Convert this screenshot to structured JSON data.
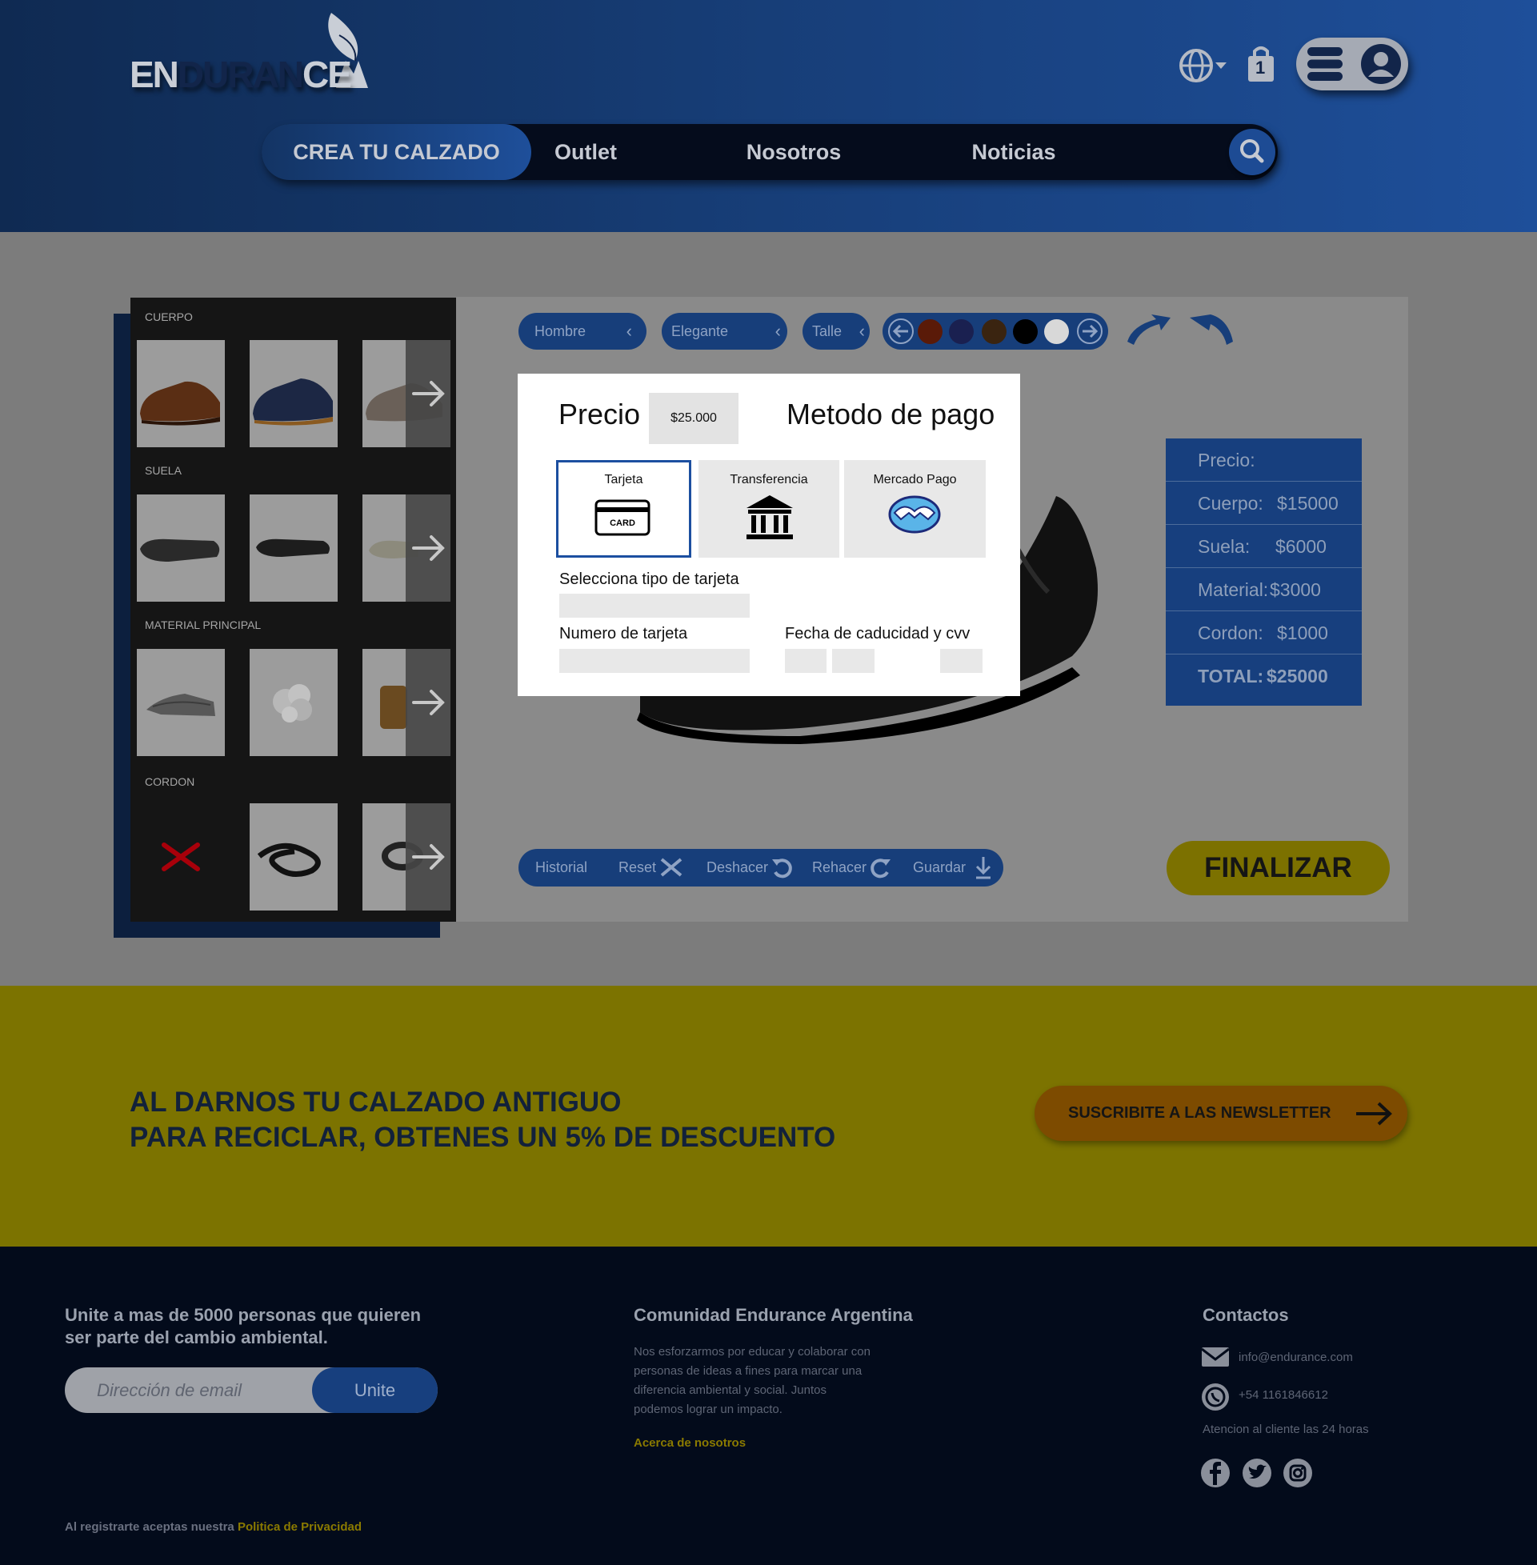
{
  "header": {
    "logo": {
      "part1": "EN",
      "part2": "DURAN",
      "part3": "CE"
    },
    "bag_count": "1",
    "nav": [
      {
        "label": "CREA TU CALZADO",
        "active": true
      },
      {
        "label": "Outlet"
      },
      {
        "label": "Nosotros"
      },
      {
        "label": "Noticias"
      }
    ]
  },
  "builder": {
    "sections": [
      {
        "label": "CUERPO"
      },
      {
        "label": "SUELA"
      },
      {
        "label": "MATERIAL PRINCIPAL"
      },
      {
        "label": "CORDON"
      }
    ],
    "filters": [
      {
        "label": "Hombre"
      },
      {
        "label": "Elegante"
      },
      {
        "label": "Talle"
      }
    ],
    "swatch_colors": [
      "#5a1a08",
      "#1a2050",
      "#3a2410",
      "#000000",
      "#d8d8d8"
    ],
    "price_table": {
      "header": "Precio:",
      "rows": [
        {
          "label": "Cuerpo:",
          "value": "$15000"
        },
        {
          "label": "Suela:",
          "value": "$6000"
        },
        {
          "label": "Material:",
          "value": "$3000"
        },
        {
          "label": "Cordon:",
          "value": "$1000"
        }
      ],
      "total_label": "TOTAL:",
      "total_value": "$25000"
    },
    "history": {
      "historial": "Historial",
      "reset": "Reset",
      "deshacer": "Deshacer",
      "rehacer": "Rehacer",
      "guardar": "Guardar"
    },
    "finalizar": "FINALIZAR"
  },
  "modal": {
    "precio_label": "Precio",
    "precio_value": "$25.000",
    "metodo_label": "Metodo de pago",
    "methods": [
      {
        "label": "Tarjeta",
        "selected": true
      },
      {
        "label": "Transferencia"
      },
      {
        "label": "Mercado Pago"
      }
    ],
    "card_text": "CARD",
    "tipo_tarjeta_label": "Selecciona tipo de tarjeta",
    "numero_label": "Numero de tarjeta",
    "fecha_label": "Fecha de caducidad y cvv"
  },
  "promo": {
    "line1": "AL DARNOS TU CALZADO ANTIGUO",
    "line2": "PARA RECICLAR, OBTENES UN 5% DE DESCUENTO",
    "newsletter_label": "SUSCRIBITE A LAS NEWSLETTER"
  },
  "footer": {
    "join_heading_1": "Unite a mas de 5000 personas que quieren",
    "join_heading_2": "ser parte del cambio ambiental.",
    "email_placeholder": "Dirección de email",
    "unite_label": "Unite",
    "community_heading": "Comunidad Endurance Argentina",
    "community_lines": [
      "Nos esforzarmos por educar y colaborar con",
      "personas de ideas a fines para marcar una",
      "diferencia ambiental y social. Juntos",
      "podemos lograr un impacto."
    ],
    "about_link": "Acerca de nosotros",
    "contacts_heading": "Contactos",
    "email": "info@endurance.com",
    "phone": "+54 1161846612",
    "hours": "Atencion al cliente las 24 horas",
    "legal_text": "Al registrarte aceptas nuestra",
    "privacy_link": "Politica de Privacidad"
  }
}
